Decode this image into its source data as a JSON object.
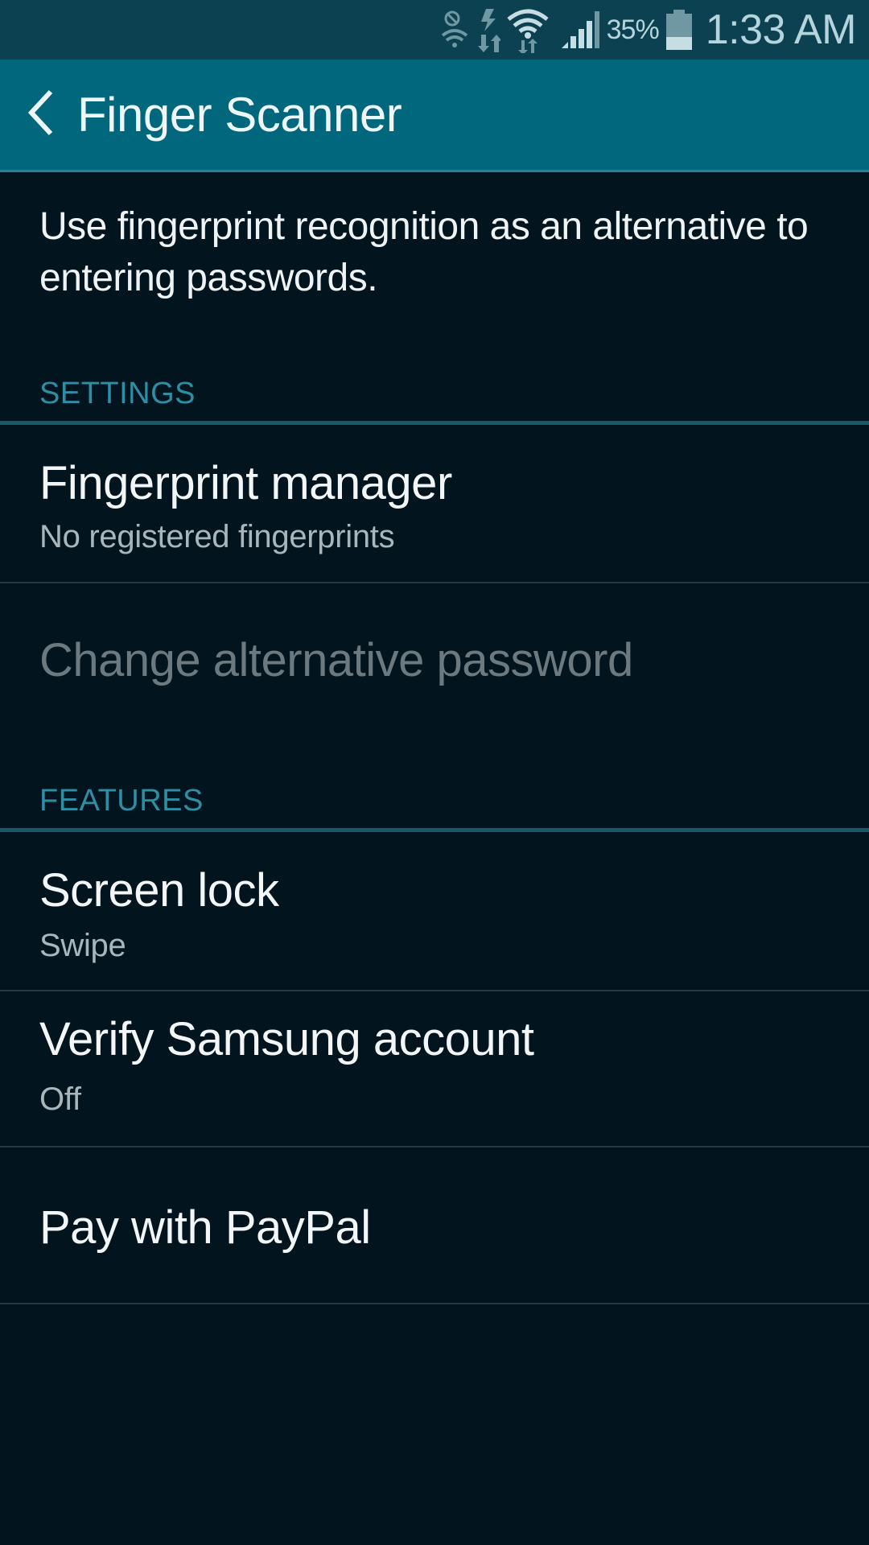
{
  "status_bar": {
    "icons": [
      "wifi-calling-blocked-icon",
      "data-activity-icon",
      "wifi-icon",
      "cellular-signal-icon",
      "battery-icon"
    ],
    "battery_percent": "35%",
    "battery_level": 0.35,
    "time": "1:33 AM"
  },
  "action_bar": {
    "back_icon": "chevron-left-icon",
    "title": "Finger Scanner"
  },
  "description": "Use fingerprint recognition as an alternative to entering passwords.",
  "sections": [
    {
      "header": "SETTINGS",
      "items": [
        {
          "title": "Fingerprint manager",
          "subtitle": "No registered fingerprints",
          "enabled": true
        },
        {
          "title": "Change alternative password",
          "subtitle": null,
          "enabled": false
        }
      ]
    },
    {
      "header": "FEATURES",
      "items": [
        {
          "title": "Screen lock",
          "subtitle": "Swipe",
          "enabled": true
        },
        {
          "title": "Verify Samsung account",
          "subtitle": "Off",
          "enabled": true
        },
        {
          "title": "Pay with PayPal",
          "subtitle": null,
          "enabled": true
        }
      ]
    }
  ],
  "colors": {
    "status_bar_bg": "#0b4150",
    "action_bar_bg": "#00677d",
    "page_bg": "#02151e",
    "section_header_text": "#2e8ea6",
    "section_divider": "#185a68",
    "disabled_text": "#6c7a80"
  }
}
